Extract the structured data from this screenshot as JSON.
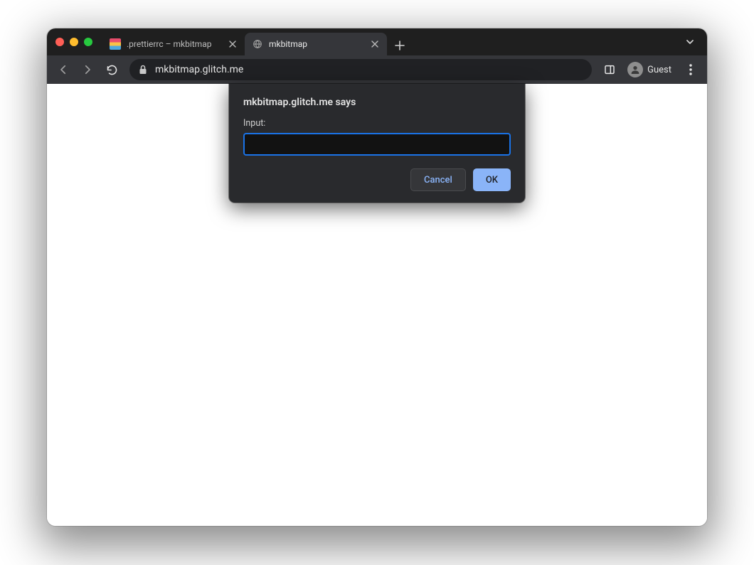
{
  "tabs": [
    {
      "label": ".prettierrc – mkbitmap",
      "active": false
    },
    {
      "label": "mkbitmap",
      "active": true
    }
  ],
  "toolbar": {
    "url": "mkbitmap.glitch.me",
    "guest_label": "Guest"
  },
  "dialog": {
    "title": "mkbitmap.glitch.me says",
    "label": "Input:",
    "input_value": "",
    "cancel_label": "Cancel",
    "ok_label": "OK"
  }
}
